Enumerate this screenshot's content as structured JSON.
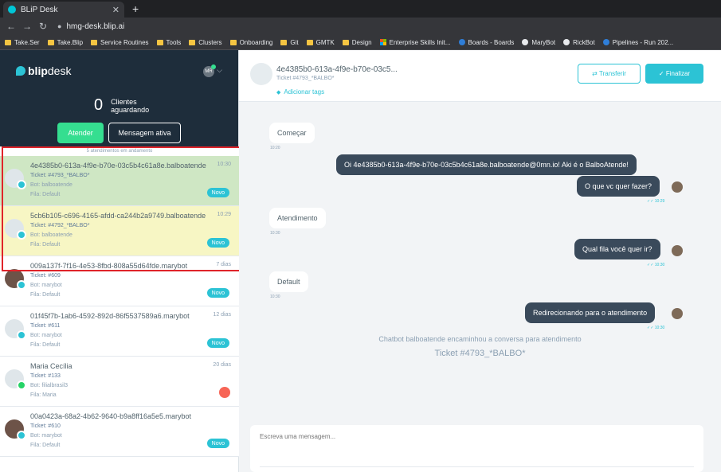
{
  "browser": {
    "tab_title": "BLiP Desk",
    "url": "hmg-desk.blip.ai",
    "bookmarks": [
      {
        "label": "Take.Ser",
        "type": "folder"
      },
      {
        "label": "Take.Blip",
        "type": "folder"
      },
      {
        "label": "Service Routines",
        "type": "folder"
      },
      {
        "label": "Tools",
        "type": "folder"
      },
      {
        "label": "Clusters",
        "type": "folder"
      },
      {
        "label": "Onboarding",
        "type": "folder"
      },
      {
        "label": "Git",
        "type": "folder"
      },
      {
        "label": "GMTK",
        "type": "folder"
      },
      {
        "label": "Design",
        "type": "folder"
      },
      {
        "label": "Enterprise Skills Init...",
        "type": "ms"
      },
      {
        "label": "Boards - Boards",
        "type": "ado"
      },
      {
        "label": "MaryBot",
        "type": "gh"
      },
      {
        "label": "RickBot",
        "type": "gh"
      },
      {
        "label": "Pipelines - Run 202...",
        "type": "ado"
      }
    ]
  },
  "sidebar": {
    "logo_bold": "blip",
    "logo_rest": "desk",
    "user_initials": "MR",
    "waiting_count": "0",
    "waiting_label_1": "Clientes",
    "waiting_label_2": "aguardando",
    "attend_button": "Atender",
    "active_message_button": "Mensagem ativa",
    "in_progress_label": "5 atendimentos em andamento",
    "tickets": [
      {
        "title": "4e4385b0-613a-4f9e-b70e-03c5b4c61a8e.balboatende",
        "ticket": "Ticket: #4793_*BALBO*",
        "bot": "Bot: balboatende",
        "fila": "Fila: Default",
        "time": "10:30",
        "badge": "Novo",
        "state": "active",
        "avatar": "default",
        "channel": "blip"
      },
      {
        "title": "5cb6b105-c696-4165-afdd-ca244b2a9749.balboatende",
        "ticket": "Ticket: #4792_*BALBO*",
        "bot": "Bot: balboatende",
        "fila": "Fila: Default",
        "time": "10:29",
        "badge": "Novo",
        "state": "pending",
        "avatar": "default",
        "channel": "blip"
      },
      {
        "title": "009a137f-7f16-4e53-8fbd-808a55d64fde.marybot",
        "ticket": "Ticket: #609",
        "bot": "Bot: marybot",
        "fila": "Fila: Default",
        "time": "7 dias",
        "badge": "Novo",
        "state": "normal",
        "avatar": "photo",
        "channel": "blip"
      },
      {
        "title": "01f45f7b-1ab6-4592-892d-86f5537589a6.marybot",
        "ticket": "Ticket: #611",
        "bot": "Bot: marybot",
        "fila": "Fila: Default",
        "time": "12 dias",
        "badge": "Novo",
        "state": "normal",
        "avatar": "default",
        "channel": "blip"
      },
      {
        "title": "Maria Cecília",
        "ticket": "Ticket: #133",
        "bot": "Bot: filialbrasil3",
        "fila": "Fila: Maria",
        "time": "20 dias",
        "badge": "",
        "state": "normal",
        "avatar": "default",
        "channel": "whatsapp"
      },
      {
        "title": "00a0423a-68a2-4b62-9640-b9a8ff16a5e5.marybot",
        "ticket": "Ticket: #610",
        "bot": "Bot: marybot",
        "fila": "Fila: Default",
        "time": "",
        "badge": "Novo",
        "state": "normal",
        "avatar": "photo",
        "channel": "blip"
      }
    ]
  },
  "chat": {
    "title": "4e4385b0-613a-4f9e-b70e-03c5...",
    "ticket": "Ticket #4793_*BALBO*",
    "add_tags": "Adicionar tags",
    "transfer_button": "Transferir",
    "finish_button": "Finalizar",
    "messages": [
      {
        "text": "Começar",
        "time": "10:20"
      },
      {
        "text": "Oi 4e4385b0-613a-4f9e-b70e-03c5b4c61a8e.balboatende@0mn.io! Aki é o BalboAtende!"
      },
      {
        "text": "O que vc quer fazer?",
        "time": "10:29"
      },
      {
        "text": "Atendimento",
        "time": "10:30"
      },
      {
        "text": "Qual fila você quer ir?",
        "time": "10:30"
      },
      {
        "text": "Default",
        "time": "10:30"
      },
      {
        "text": "Redirecionando para o atendimento",
        "time": "10:30"
      }
    ],
    "system_message": "Chatbot balboatende encaminhou a conversa para atendimento",
    "system_ticket": "Ticket #4793_*BALBO*",
    "compose_placeholder": "Escreva uma mensagem..."
  },
  "colors": {
    "accent": "#2cc3d5",
    "green": "#35de90",
    "dark": "#1e2d3b",
    "highlight": "#e0242a"
  }
}
